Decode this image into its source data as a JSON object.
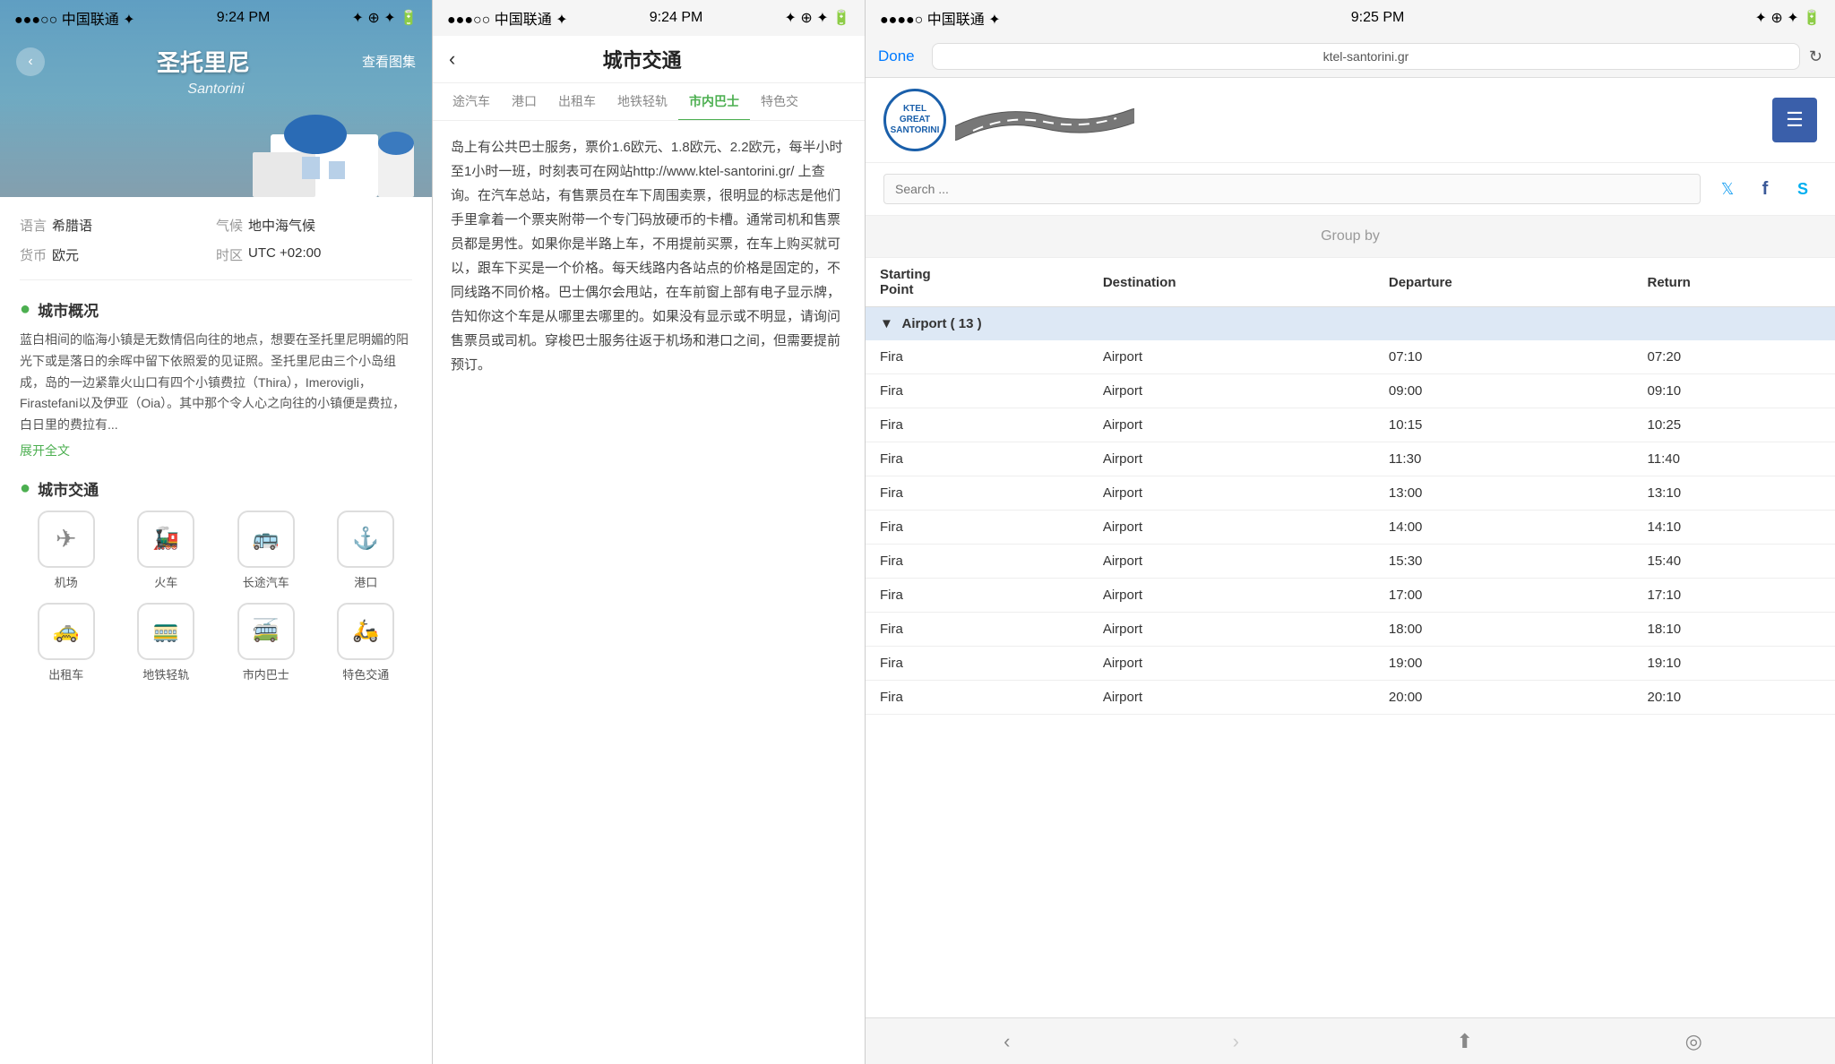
{
  "panel1": {
    "status": {
      "left": "●●●○○ 中国联通 ✦",
      "center": "9:24 PM",
      "right": "✦ ⊕ ✦ 🔋"
    },
    "back_label": "‹",
    "title": "圣托里尼",
    "gallery_label": "查看图集",
    "subtitle": "Santorini",
    "info": [
      {
        "label": "语言",
        "value": "希腊语"
      },
      {
        "label": "气候",
        "value": "地中海气候"
      },
      {
        "label": "货币",
        "value": "欧元"
      },
      {
        "label": "时区",
        "value": "UTC +02:00"
      }
    ],
    "sections": [
      {
        "id": "city-overview",
        "title": "城市概况",
        "content": "蓝白相间的临海小镇是无数情侣向往的地点，想要在圣托里尼明媚的阳光下或是落日的余晖中留下依照爱的见证照。圣托里尼由三个小岛组成，岛的一边紧靠火山口有四个小镇费拉（Thira），Imerovigli，Firastefani以及伊亚（Oia）。其中那个令人心之向往的小镇便是费拉，白日里的费拉有...",
        "expand": "展开全文"
      },
      {
        "id": "city-transport",
        "title": "城市交通",
        "items": [
          {
            "icon": "✈",
            "label": "机场"
          },
          {
            "icon": "🚂",
            "label": "火车"
          },
          {
            "icon": "🚌",
            "label": "长途汽车"
          },
          {
            "icon": "⚓",
            "label": "港口"
          },
          {
            "icon": "🚕",
            "label": "出租车"
          },
          {
            "icon": "🚃",
            "label": "地铁轻轨"
          },
          {
            "icon": "🚎",
            "label": "市内巴士"
          },
          {
            "icon": "🛵",
            "label": "特色交通"
          }
        ]
      }
    ]
  },
  "panel2": {
    "status": {
      "left": "●●●○○ 中国联通 ✦",
      "center": "9:24 PM",
      "right": "✦ ⊕ ✦ 🔋"
    },
    "nav_back": "‹",
    "nav_title": "城市交通",
    "tabs": [
      {
        "label": "途汽车",
        "active": false
      },
      {
        "label": "港口",
        "active": false
      },
      {
        "label": "出租车",
        "active": false
      },
      {
        "label": "地铁轻轨",
        "active": false
      },
      {
        "label": "市内巴士",
        "active": true
      },
      {
        "label": "特色交",
        "active": false
      }
    ],
    "body_text": "岛上有公共巴士服务，票价1.6欧元、1.8欧元、2.2欧元，每半小时至1小时一班，时刻表可在网站http://www.ktel-santorini.gr/ 上查询。在汽车总站，有售票员在车下周围卖票，很明显的标志是他们手里拿着一个票夹附带一个专门码放硬币的卡槽。通常司机和售票员都是男性。如果你是半路上车，不用提前买票，在车上购买就可以，跟车下买是一个价格。每天线路内各站点的价格是固定的，不同线路不同价格。巴士偶尔会甩站，在车前窗上部有电子显示牌，告知你这个车是从哪里去哪里的。如果没有显示或不明显，请询问售票员或司机。穿梭巴士服务往返于机场和港口之间，但需要提前预订。"
  },
  "panel3": {
    "status": {
      "left": "●●●●○ 中国联通 ✦",
      "center": "9:25 PM",
      "right": "✦ ⊕ ✦ 🔋"
    },
    "done_label": "Done",
    "url": "ktel-santorini.gr",
    "logo_text": "KTEL\nGREAT\nSANTORINI",
    "menu_icon": "☰",
    "search_placeholder": "Search ...",
    "social": [
      {
        "icon": "𝕏",
        "name": "twitter"
      },
      {
        "icon": "f",
        "name": "facebook"
      },
      {
        "icon": "S",
        "name": "skype"
      }
    ],
    "group_by_label": "Group by",
    "table_headers": [
      "Starting Point",
      "Destination",
      "Departure",
      "Return"
    ],
    "airport_group": "Airport ( 13 )",
    "rows": [
      {
        "from": "Fira",
        "to": "Airport",
        "dep": "07:10",
        "ret": "07:20"
      },
      {
        "from": "Fira",
        "to": "Airport",
        "dep": "09:00",
        "ret": "09:10"
      },
      {
        "from": "Fira",
        "to": "Airport",
        "dep": "10:15",
        "ret": "10:25"
      },
      {
        "from": "Fira",
        "to": "Airport",
        "dep": "11:30",
        "ret": "11:40"
      },
      {
        "from": "Fira",
        "to": "Airport",
        "dep": "13:00",
        "ret": "13:10"
      },
      {
        "from": "Fira",
        "to": "Airport",
        "dep": "14:00",
        "ret": "14:10"
      },
      {
        "from": "Fira",
        "to": "Airport",
        "dep": "15:30",
        "ret": "15:40"
      },
      {
        "from": "Fira",
        "to": "Airport",
        "dep": "17:00",
        "ret": "17:10"
      },
      {
        "from": "Fira",
        "to": "Airport",
        "dep": "18:00",
        "ret": "18:10"
      },
      {
        "from": "Fira",
        "to": "Airport",
        "dep": "19:00",
        "ret": "19:10"
      },
      {
        "from": "Fira",
        "to": "Airport",
        "dep": "20:00",
        "ret": "20:10"
      }
    ],
    "bottom_nav": [
      {
        "icon": "‹",
        "label": "back",
        "enabled": true
      },
      {
        "icon": "›",
        "label": "forward",
        "enabled": false
      },
      {
        "icon": "⬆",
        "label": "share",
        "enabled": true
      },
      {
        "icon": "◉",
        "label": "bookmark",
        "enabled": true
      }
    ]
  }
}
